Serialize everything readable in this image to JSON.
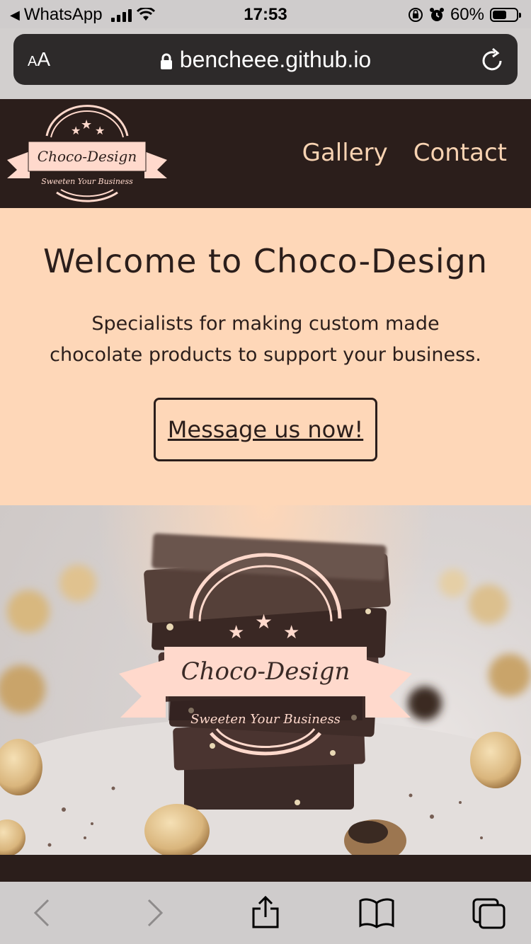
{
  "status_bar": {
    "back_app": "WhatsApp",
    "time": "17:53",
    "battery_percent": "60%",
    "battery_level": 0.6
  },
  "browser": {
    "text_size_label_small": "A",
    "text_size_label_large": "A",
    "url": "bencheee.github.io"
  },
  "site": {
    "logo_title": "Choco-Design",
    "logo_tagline": "Sweeten Your Business",
    "nav": [
      {
        "label": "Gallery"
      },
      {
        "label": "Contact"
      }
    ]
  },
  "hero": {
    "title": "Welcome to Choco-Design",
    "subtitle_line1": "Specialists for making custom made",
    "subtitle_line2": "chocolate products to support your business.",
    "cta_label": "Message us now!"
  },
  "banner": {
    "logo_title": "Choco-Design",
    "logo_tagline": "Sweeten Your Business"
  },
  "toolbar": {
    "icons": [
      "back-arrow-icon",
      "forward-arrow-icon",
      "share-icon",
      "bookmarks-icon",
      "tabs-icon"
    ]
  },
  "colors": {
    "dark_brown": "#2b1e1b",
    "peach": "#fed7b8",
    "pink_ribbon": "#ffd9cc",
    "nav_text": "#f8d3b2"
  }
}
